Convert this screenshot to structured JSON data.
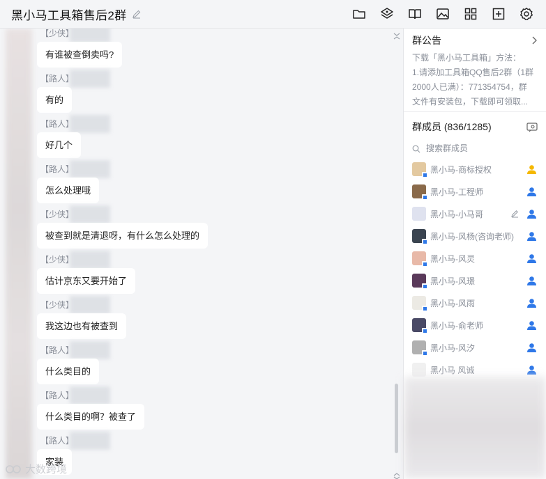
{
  "header": {
    "title": "黑小马工具箱售后2群",
    "tools": [
      "folder-icon",
      "share-icon",
      "book-icon",
      "image-icon",
      "apps-icon",
      "add-icon",
      "settings-icon"
    ]
  },
  "chat": {
    "messages": [
      {
        "sender": "【少侠】",
        "text": "有谁被查倒卖吗?"
      },
      {
        "sender": "【路人】",
        "text": "有的"
      },
      {
        "sender": "【路人】",
        "text": "好几个"
      },
      {
        "sender": "【路人】",
        "text": "怎么处理哦"
      },
      {
        "sender": "【少侠】",
        "text": "被查到就是清退呀，有什么怎么处理的"
      },
      {
        "sender": "【少侠】",
        "text": "估计京东又要开始了"
      },
      {
        "sender": "【少侠】",
        "text": "我这边也有被查到"
      },
      {
        "sender": "【路人】",
        "text": "什么类目的"
      },
      {
        "sender": "【路人】",
        "text": "什么类目的啊？被查了"
      },
      {
        "sender": "【路人】",
        "text": "家装"
      }
    ],
    "watermark": "大数跨境"
  },
  "sidebar": {
    "notice": {
      "title": "群公告",
      "lines": [
        "下载「黑小马工具箱」方法：",
        "1.请添加工具箱QQ售后2群（1群",
        "2000人已满）：771354754，群",
        "文件有安装包，下载即可领取..."
      ]
    },
    "members": {
      "title": "群成员 (836/1285)",
      "search_placeholder": "搜索群成员",
      "list": [
        {
          "name": "黑小马-商标授权",
          "role": "owner",
          "color": "#e3c9a0"
        },
        {
          "name": "黑小马-工程师",
          "role": "admin",
          "color": "#8a6a4a"
        },
        {
          "name": "黑小马-小马哥",
          "role": "admin",
          "color": "#dfe2ef"
        },
        {
          "name": "黑小马-风杨(咨询老师)",
          "role": "admin",
          "color": "#3a4450"
        },
        {
          "name": "黑小马-风灵",
          "role": "admin",
          "color": "#e8b9a8"
        },
        {
          "name": "黑小马-风璟",
          "role": "admin",
          "color": "#5a3a5a"
        },
        {
          "name": "黑小马-风雨",
          "role": "admin",
          "color": "#eceae4"
        },
        {
          "name": "黑小马-俞老师",
          "role": "admin",
          "color": "#4a4a66"
        },
        {
          "name": "黑小马-风汐",
          "role": "admin",
          "color": "#b0b0b0"
        },
        {
          "name": "黑小马 风诚",
          "role": "admin",
          "color": "#f0f0f0"
        }
      ]
    }
  },
  "colors": {
    "owner": "#f5b800",
    "admin": "#2f78e8",
    "bubble": "#ffffff",
    "background": "#f4f5f7"
  }
}
